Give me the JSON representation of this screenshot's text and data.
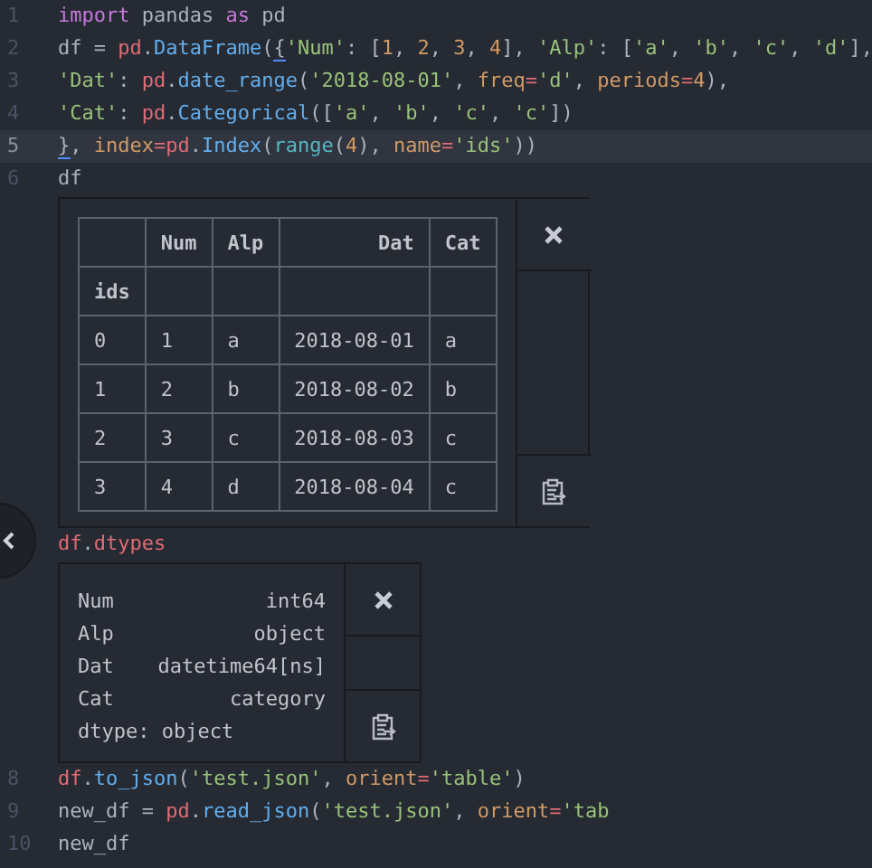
{
  "code_lines": [
    {
      "number": "1",
      "selected": false,
      "tokens": [
        {
          "text": "import",
          "kind": "keyword"
        },
        {
          "text": " pandas ",
          "kind": "plain"
        },
        {
          "text": "as",
          "kind": "keyword"
        },
        {
          "text": " pd",
          "kind": "plain"
        }
      ]
    },
    {
      "number": "2",
      "selected": false,
      "tokens": [
        {
          "text": "df = ",
          "kind": "plain"
        },
        {
          "text": "pd",
          "kind": "variable"
        },
        {
          "text": ".",
          "kind": "plain"
        },
        {
          "text": "DataFrame",
          "kind": "function"
        },
        {
          "text": "(",
          "kind": "plain"
        },
        {
          "text": "{",
          "kind": "match"
        },
        {
          "text": "'Num'",
          "kind": "string"
        },
        {
          "text": ": [",
          "kind": "plain"
        },
        {
          "text": "1",
          "kind": "number"
        },
        {
          "text": ", ",
          "kind": "plain"
        },
        {
          "text": "2",
          "kind": "number"
        },
        {
          "text": ", ",
          "kind": "plain"
        },
        {
          "text": "3",
          "kind": "number"
        },
        {
          "text": ", ",
          "kind": "plain"
        },
        {
          "text": "4",
          "kind": "number"
        },
        {
          "text": "], ",
          "kind": "plain"
        },
        {
          "text": "'Alp'",
          "kind": "string"
        },
        {
          "text": ": [",
          "kind": "plain"
        },
        {
          "text": "'a'",
          "kind": "string"
        },
        {
          "text": ", ",
          "kind": "plain"
        },
        {
          "text": "'b'",
          "kind": "string"
        },
        {
          "text": ", ",
          "kind": "plain"
        },
        {
          "text": "'c'",
          "kind": "string"
        },
        {
          "text": ", ",
          "kind": "plain"
        },
        {
          "text": "'d'",
          "kind": "string"
        },
        {
          "text": "],",
          "kind": "plain"
        }
      ]
    },
    {
      "number": "3",
      "selected": false,
      "tokens": [
        {
          "text": "'Dat'",
          "kind": "string"
        },
        {
          "text": ": ",
          "kind": "plain"
        },
        {
          "text": "pd",
          "kind": "variable"
        },
        {
          "text": ".",
          "kind": "plain"
        },
        {
          "text": "date_range",
          "kind": "function"
        },
        {
          "text": "(",
          "kind": "plain"
        },
        {
          "text": "'2018-08-01'",
          "kind": "string"
        },
        {
          "text": ", ",
          "kind": "plain"
        },
        {
          "text": "freq",
          "kind": "param"
        },
        {
          "text": "=",
          "kind": "operator"
        },
        {
          "text": "'d'",
          "kind": "string"
        },
        {
          "text": ", ",
          "kind": "plain"
        },
        {
          "text": "periods",
          "kind": "param"
        },
        {
          "text": "=",
          "kind": "operator"
        },
        {
          "text": "4",
          "kind": "number"
        },
        {
          "text": "),",
          "kind": "plain"
        }
      ]
    },
    {
      "number": "4",
      "selected": false,
      "tokens": [
        {
          "text": "'Cat'",
          "kind": "string"
        },
        {
          "text": ": ",
          "kind": "plain"
        },
        {
          "text": "pd",
          "kind": "variable"
        },
        {
          "text": ".",
          "kind": "plain"
        },
        {
          "text": "Categorical",
          "kind": "function"
        },
        {
          "text": "([",
          "kind": "plain"
        },
        {
          "text": "'a'",
          "kind": "string"
        },
        {
          "text": ", ",
          "kind": "plain"
        },
        {
          "text": "'b'",
          "kind": "string"
        },
        {
          "text": ", ",
          "kind": "plain"
        },
        {
          "text": "'c'",
          "kind": "string"
        },
        {
          "text": ", ",
          "kind": "plain"
        },
        {
          "text": "'c'",
          "kind": "string"
        },
        {
          "text": "])",
          "kind": "plain"
        }
      ]
    },
    {
      "number": "5",
      "selected": true,
      "tokens": [
        {
          "text": "}",
          "kind": "match"
        },
        {
          "text": ", ",
          "kind": "plain"
        },
        {
          "text": "index",
          "kind": "param"
        },
        {
          "text": "=",
          "kind": "operator"
        },
        {
          "text": "pd",
          "kind": "variable"
        },
        {
          "text": ".",
          "kind": "plain"
        },
        {
          "text": "Index",
          "kind": "function"
        },
        {
          "text": "(",
          "kind": "plain"
        },
        {
          "text": "range",
          "kind": "builtin"
        },
        {
          "text": "(",
          "kind": "plain"
        },
        {
          "text": "4",
          "kind": "number"
        },
        {
          "text": "), ",
          "kind": "plain"
        },
        {
          "text": "name",
          "kind": "param"
        },
        {
          "text": "=",
          "kind": "operator"
        },
        {
          "text": "'ids'",
          "kind": "string"
        },
        {
          "text": "))",
          "kind": "plain"
        }
      ]
    },
    {
      "number": "6",
      "selected": false,
      "tokens": [
        {
          "text": "df",
          "kind": "plain"
        }
      ],
      "output": {
        "kind": "table",
        "columns": [
          "",
          "Num",
          "Alp",
          "Dat",
          "Cat"
        ],
        "index_name": "ids",
        "rows": [
          [
            "0",
            "1",
            "a",
            "2018-08-01",
            "a"
          ],
          [
            "1",
            "2",
            "b",
            "2018-08-02",
            "b"
          ],
          [
            "2",
            "3",
            "c",
            "2018-08-03",
            "c"
          ],
          [
            "3",
            "4",
            "d",
            "2018-08-04",
            "c"
          ]
        ]
      }
    },
    {
      "selected": false,
      "tokens": [
        {
          "text": "df",
          "kind": "variable"
        },
        {
          "text": ".",
          "kind": "plain"
        },
        {
          "text": "dtypes",
          "kind": "variable"
        }
      ],
      "output": {
        "kind": "series",
        "rows": [
          [
            "Num",
            "int64"
          ],
          [
            "Alp",
            "object"
          ],
          [
            "Dat",
            "datetime64[ns]"
          ],
          [
            "Cat",
            "category"
          ]
        ],
        "footer": "dtype: object"
      }
    },
    {
      "number": "8",
      "selected": false,
      "tokens": [
        {
          "text": "df",
          "kind": "variable"
        },
        {
          "text": ".",
          "kind": "plain"
        },
        {
          "text": "to_json",
          "kind": "function"
        },
        {
          "text": "(",
          "kind": "plain"
        },
        {
          "text": "'test.json'",
          "kind": "string"
        },
        {
          "text": ", ",
          "kind": "plain"
        },
        {
          "text": "orient",
          "kind": "param"
        },
        {
          "text": "=",
          "kind": "operator"
        },
        {
          "text": "'table'",
          "kind": "string"
        },
        {
          "text": ")",
          "kind": "plain"
        }
      ]
    },
    {
      "number": "9",
      "selected": false,
      "tokens": [
        {
          "text": "new_df = ",
          "kind": "plain"
        },
        {
          "text": "pd",
          "kind": "variable"
        },
        {
          "text": ".",
          "kind": "plain"
        },
        {
          "text": "read_json",
          "kind": "function"
        },
        {
          "text": "(",
          "kind": "plain"
        },
        {
          "text": "'test.json'",
          "kind": "string"
        },
        {
          "text": ", ",
          "kind": "plain"
        },
        {
          "text": "orient",
          "kind": "param"
        },
        {
          "text": "=",
          "kind": "operator"
        },
        {
          "text": "'tab",
          "kind": "string"
        }
      ]
    },
    {
      "number": "10",
      "selected": false,
      "tokens": [
        {
          "text": "new_df",
          "kind": "plain"
        }
      ]
    }
  ]
}
